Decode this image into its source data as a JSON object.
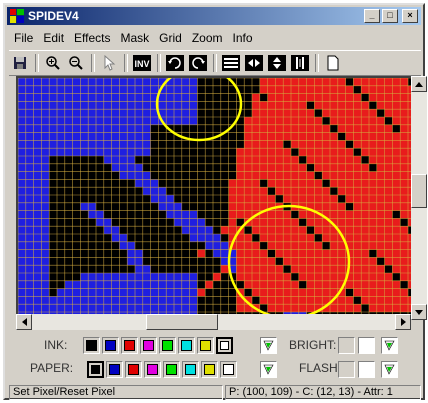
{
  "window": {
    "title": "SPIDEV4"
  },
  "title_buttons": {
    "minimize": "_",
    "maximize": "□",
    "close": "×"
  },
  "menu": [
    {
      "label": "File"
    },
    {
      "label": "Edit"
    },
    {
      "label": "Effects"
    },
    {
      "label": "Mask"
    },
    {
      "label": "Grid"
    },
    {
      "label": "Zoom"
    },
    {
      "label": "Info"
    }
  ],
  "toolbar": {
    "tools": [
      "save-icon",
      "zoom-in-icon",
      "zoom-out-icon",
      "pointer-icon",
      "invert-icon",
      "rotate-left-icon",
      "rotate-right-icon",
      "flip-horizontal-icon",
      "flip-vertical-icon",
      "mirror-horizontal-icon",
      "mirror-vertical-icon",
      "new-page-icon"
    ],
    "invert_label": "INV"
  },
  "palette": {
    "ink_label": "INK:",
    "paper_label": "PAPER:",
    "bright_label": "BRIGHT:",
    "flash_label": "FLASH:",
    "colors": [
      "#000000",
      "#0000c0",
      "#e00000",
      "#e000e0",
      "#00e000",
      "#00e0e0",
      "#e0e000",
      "#ffffff"
    ],
    "ink_selected": 7,
    "paper_selected": 0
  },
  "status": {
    "hint": "Set Pixel/Reset Pixel",
    "position": "P: (100, 109) - C: (12, 13) - Attr: 1"
  },
  "accent": {
    "highlight_circle": "#ffff00",
    "grid_line": "#d8b040"
  }
}
